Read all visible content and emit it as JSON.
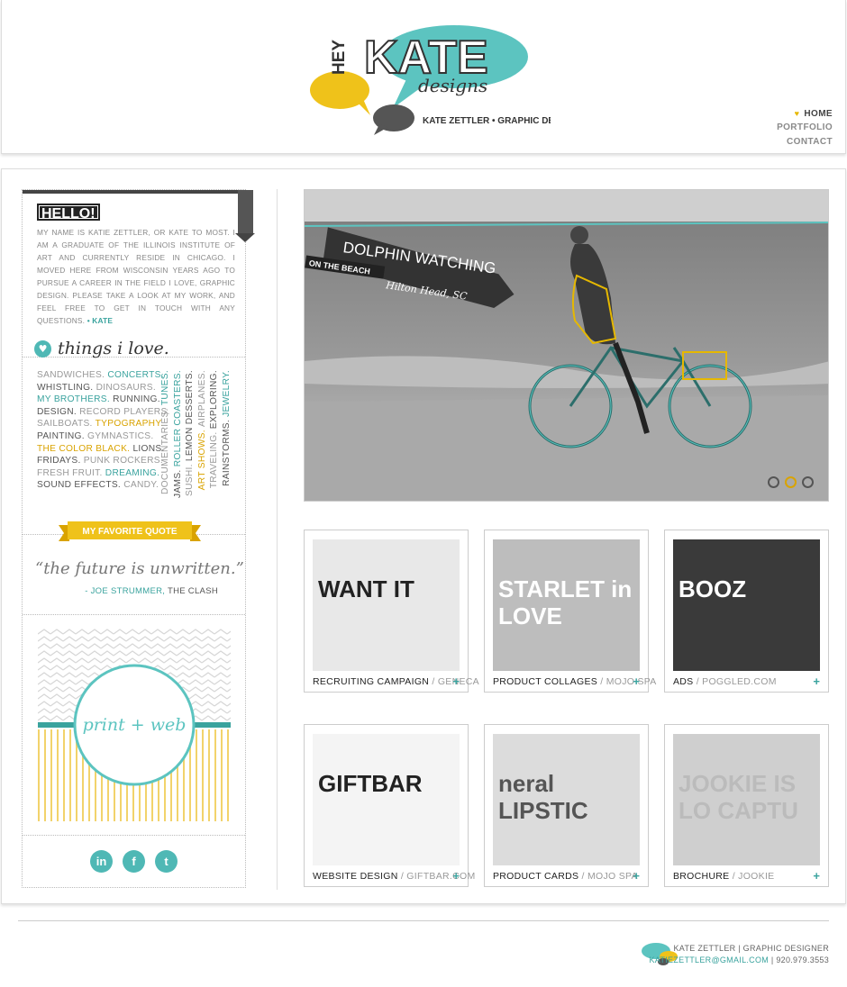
{
  "header": {
    "logo": {
      "word_hey": "HEY",
      "word_kate": "KATE",
      "word_designs": "designs",
      "tagline": "KATE ZETTLER • GRAPHIC DESIGNER"
    },
    "nav": [
      {
        "label": "HOME",
        "active": true
      },
      {
        "label": "PORTFOLIO"
      },
      {
        "label": "CONTACT"
      }
    ]
  },
  "sidebar": {
    "hello_title": "HELLO!",
    "intro": "MY NAME IS KATIE ZETTLER, OR KATE TO MOST. I AM A GRADUATE OF THE ILLINOIS INSTITUTE OF ART AND CURRENTLY RESIDE IN CHICAGO. I MOVED HERE FROM WISCONSIN YEARS AGO TO PURSUE A CAREER IN THE FIELD I LOVE, GRAPHIC DESIGN. PLEASE TAKE A LOOK AT MY WORK, AND FEEL FREE TO GET IN TOUCH WITH ANY QUESTIONS.",
    "intro_sig": "• KATE",
    "things_title": "things i love.",
    "loves": [
      {
        "text": "SANDWICHES.",
        "c": "g"
      },
      {
        "text": "CONCERTS.",
        "c": "t"
      },
      {
        "text": "WHISTLING.",
        "c": ""
      },
      {
        "text": "DINOSAURS.",
        "c": "g"
      },
      {
        "text": "MY BROTHERS.",
        "c": "t"
      },
      {
        "text": "RUNNING.",
        "c": ""
      },
      {
        "text": "DESIGN.",
        "c": ""
      },
      {
        "text": "RECORD PLAYERS.",
        "c": "g"
      },
      {
        "text": "SAILBOATS.",
        "c": "g"
      },
      {
        "text": "TYPOGRAPHY.",
        "c": "y"
      },
      {
        "text": "PAINTING.",
        "c": ""
      },
      {
        "text": "GYMNASTICS.",
        "c": "g"
      },
      {
        "text": "THE COLOR BLACK.",
        "c": "y"
      },
      {
        "text": "LIONS.",
        "c": ""
      },
      {
        "text": "FRIDAYS.",
        "c": ""
      },
      {
        "text": "PUNK ROCKERS.",
        "c": "g"
      },
      {
        "text": "FRESH FRUIT.",
        "c": "g"
      },
      {
        "text": "DREAMING.",
        "c": "t"
      },
      {
        "text": "SOUND EFFECTS.",
        "c": ""
      },
      {
        "text": "CANDY.",
        "c": "g"
      }
    ],
    "vertical_loves": [
      {
        "parts": [
          {
            "text": "DOCUMENTARIES.",
            "c": "g"
          },
          {
            "text": "TUNES.",
            "c": "t"
          }
        ]
      },
      {
        "parts": [
          {
            "text": "JAMS.",
            "c": ""
          },
          {
            "text": "ROLLER COASTERS.",
            "c": "t"
          }
        ]
      },
      {
        "parts": [
          {
            "text": "SUSHI.",
            "c": "g"
          },
          {
            "text": "LEMON DESSERTS.",
            "c": ""
          }
        ]
      },
      {
        "parts": [
          {
            "text": "ART SHOWS.",
            "c": "y"
          },
          {
            "text": "AIRPLANES.",
            "c": "g"
          }
        ]
      },
      {
        "parts": [
          {
            "text": "TRAVELING.",
            "c": "g"
          },
          {
            "text": "EXPLORING.",
            "c": ""
          }
        ]
      },
      {
        "parts": [
          {
            "text": "RAINSTORMS.",
            "c": ""
          },
          {
            "text": "JEWELRY.",
            "c": "t"
          }
        ]
      }
    ],
    "quote_banner": "MY FAVORITE QUOTE",
    "quote": "“the future is unwritten.”",
    "quote_author": "- JOE STRUMMER,",
    "quote_source": "THE CLASH",
    "print_web": "print + web",
    "social": [
      {
        "name": "linkedin-icon",
        "glyph": "in"
      },
      {
        "name": "facebook-icon",
        "glyph": "f"
      },
      {
        "name": "twitter-icon",
        "glyph": "t"
      }
    ]
  },
  "hero": {
    "banner_title": "DOLPHIN WATCHING",
    "banner_sub": "ON THE BEACH",
    "banner_loc": "Hilton Head, SC",
    "slides": 3,
    "active_slide": 2
  },
  "portfolio": [
    {
      "title": "RECRUITING CAMPAIGN",
      "client": "GENECA",
      "thumb_text": "WANT IT"
    },
    {
      "title": "PRODUCT COLLAGES",
      "client": "MOJO SPA",
      "thumb_text": "STARLET in LOVE"
    },
    {
      "title": "ADS",
      "client": "POGGLED.COM",
      "thumb_text": "BOOZ"
    },
    {
      "title": "WEBSITE DESIGN",
      "client": "GIFTBAR.COM",
      "thumb_text": "GIFTBAR"
    },
    {
      "title": "PRODUCT CARDS",
      "client": "MOJO SPA",
      "thumb_text": "neral LIPSTIC"
    },
    {
      "title": "BROCHURE",
      "client": "JOOKIE",
      "thumb_text": "JOOKIE IS LO CAPTU"
    }
  ],
  "footer": {
    "name": "KATE ZETTLER | GRAPHIC DESIGNER",
    "email": "KATIEZETTLER@GMAIL.COM",
    "phone": "| 920.979.3553"
  },
  "colors": {
    "teal": "#4fb8b5",
    "yellow": "#e6b800",
    "dark": "#333333"
  }
}
